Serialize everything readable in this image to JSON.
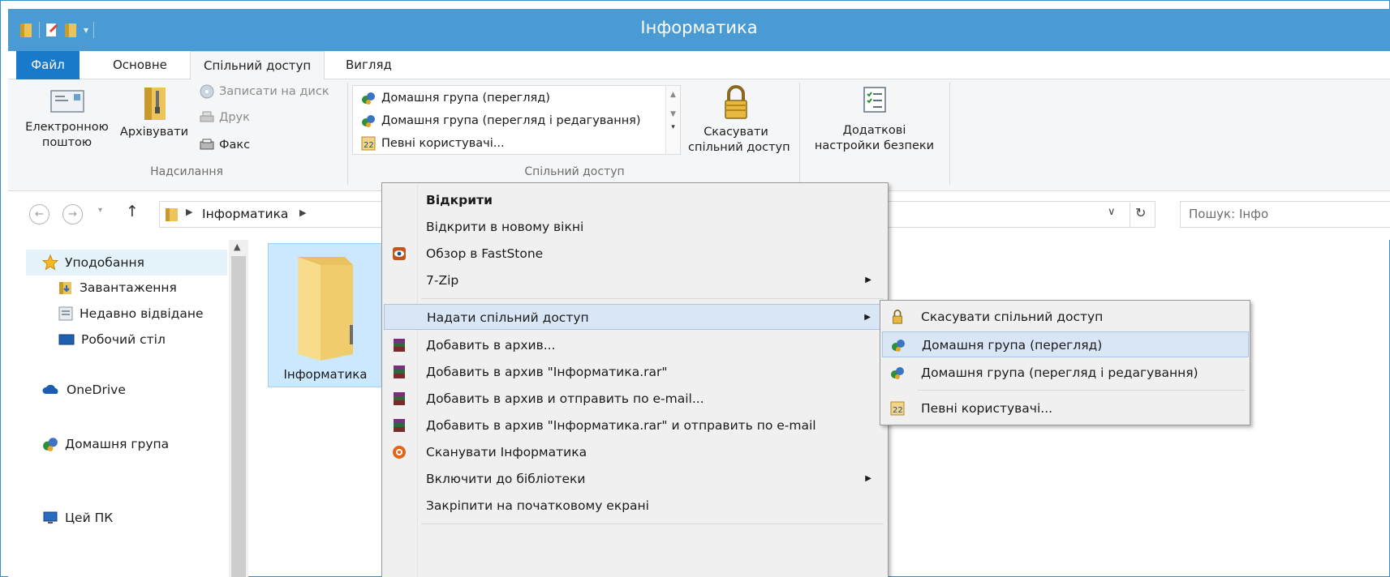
{
  "window": {
    "title": "Інформатика"
  },
  "tabs": {
    "file": "Файл",
    "home": "Основне",
    "share": "Спільний доступ",
    "view": "Вигляд"
  },
  "ribbon": {
    "send_group": {
      "email": "Електронною\nпоштою",
      "zip": "Архівувати",
      "burn": "Записати на диск",
      "print": "Друк",
      "fax": "Факс",
      "label": "Надсилання"
    },
    "share_group": {
      "gallery": [
        "Домашня група (перегляд)",
        "Домашня група (перегляд і редагування)",
        "Певні користувачі..."
      ],
      "stop_sharing": "Скасувати\nспільний доступ",
      "label": "Спільний доступ"
    },
    "security": {
      "advanced": "Додаткові\nнастройки безпеки"
    }
  },
  "address": {
    "crumb": "Інформатика",
    "search_placeholder": "Пошук: Інфо"
  },
  "nav": {
    "favorites": "Уподобання",
    "downloads": "Завантаження",
    "recent": "Недавно відвідане",
    "desktop": "Робочий стіл",
    "onedrive": "OneDrive",
    "homegroup": "Домашня група",
    "thispc": "Цей ПК"
  },
  "content": {
    "folder_name": "Інформатика"
  },
  "context_menu": {
    "open": "Відкрити",
    "open_new_window": "Відкрити в новому вікні",
    "faststone": "Обзор в FastStone",
    "sevenzip": "7-Zip",
    "share_with": "Надати спільний доступ",
    "add_archive": "Добавить в архив...",
    "add_rar": "Добавить в архив \"Інформатика.rar\"",
    "add_email": "Добавить в архив и отправить по e-mail...",
    "add_rar_email": "Добавить в архив \"Інформатика.rar\" и отправить по e-mail",
    "scan": "Сканувати Інформатика",
    "include_library": "Включити до бібліотеки",
    "pin_start": "Закріпити на початковому екрані"
  },
  "submenu": {
    "stop_sharing": "Скасувати спільний доступ",
    "hg_view": "Домашня група (перегляд)",
    "hg_edit": "Домашня група (перегляд і редагування)",
    "specific": "Певні користувачі..."
  },
  "colors": {
    "titlebar": "#4a9bd3",
    "file_tab": "#1979ca",
    "highlight": "#d8e6f5",
    "selection": "#cce8ff"
  }
}
